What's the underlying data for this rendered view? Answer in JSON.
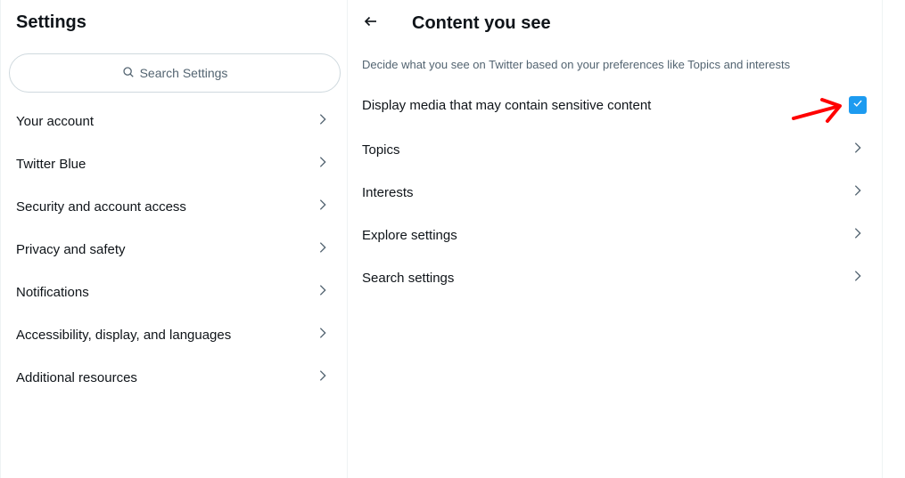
{
  "left_panel": {
    "title": "Settings",
    "search": {
      "placeholder": "Search Settings",
      "icon": "search-icon"
    },
    "items": [
      {
        "label": "Your account"
      },
      {
        "label": "Twitter Blue"
      },
      {
        "label": "Security and account access"
      },
      {
        "label": "Privacy and safety"
      },
      {
        "label": "Notifications"
      },
      {
        "label": "Accessibility, display, and languages"
      },
      {
        "label": "Additional resources"
      }
    ]
  },
  "right_panel": {
    "title": "Content you see",
    "back_icon": "arrow-left-icon",
    "subtitle": "Decide what you see on Twitter based on your preferences like Topics and interests",
    "sensitive_media": {
      "label": "Display media that may contain sensitive content",
      "checked": true
    },
    "items": [
      {
        "label": "Topics"
      },
      {
        "label": "Interests"
      },
      {
        "label": "Explore settings"
      },
      {
        "label": "Search settings"
      }
    ]
  },
  "annotation": {
    "icon": "red-arrow-icon",
    "color": "#ff0000"
  },
  "colors": {
    "accent": "#1d9bf0",
    "text_primary": "#0f1419",
    "text_secondary": "#536471",
    "border": "#eff3f4"
  }
}
